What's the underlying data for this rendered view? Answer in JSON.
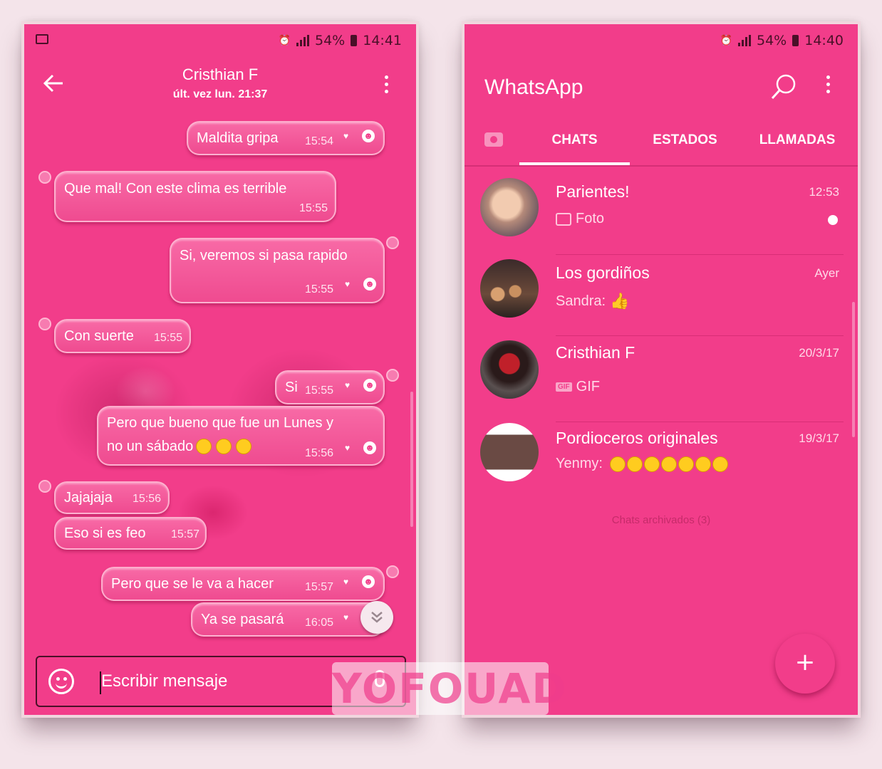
{
  "left_phone": {
    "status": {
      "battery": "54%",
      "time": "14:41"
    },
    "header": {
      "title": "Cristhian F",
      "subtitle": "últ. vez lun. 21:37"
    },
    "messages": [
      {
        "text": "Maldita gripa",
        "time": "15:54",
        "dir": "out"
      },
      {
        "text": "Que mal!  Con este clima es terrible",
        "time": "15:55",
        "dir": "in"
      },
      {
        "text": "Si, veremos si pasa rapido",
        "time": "15:55",
        "dir": "out"
      },
      {
        "text": "Con suerte",
        "time": "15:55",
        "dir": "in"
      },
      {
        "text": "Si",
        "time": "15:55",
        "dir": "out"
      },
      {
        "text": "Pero que bueno que fue un Lunes y",
        "text2": "no un sábado",
        "time": "15:56",
        "dir": "out"
      },
      {
        "text": "Jajajaja",
        "time": "15:56",
        "dir": "in"
      },
      {
        "text": "Eso si es feo",
        "time": "15:57",
        "dir": "in"
      },
      {
        "text": "Pero que se le va a hacer",
        "time": "15:57",
        "dir": "out"
      },
      {
        "text": "Ya se pasará",
        "time": "16:05",
        "dir": "out"
      }
    ],
    "composer": {
      "placeholder": "Escribir mensaje"
    }
  },
  "right_phone": {
    "status": {
      "battery": "54%",
      "time": "14:40"
    },
    "app_title": "WhatsApp",
    "tabs": [
      "CHATS",
      "ESTADOS",
      "LLAMADAS"
    ],
    "active_tab": "CHATS",
    "chats": [
      {
        "name": "Parientes!",
        "time": "12:53",
        "preview": "Foto",
        "preview_type": "photo"
      },
      {
        "name": "Los gordiños",
        "time": "Ayer",
        "preview": "Sandra:",
        "preview_type": "thumb"
      },
      {
        "name": "Cristhian F",
        "time": "20/3/17",
        "preview": "GIF",
        "preview_type": "gif"
      },
      {
        "name": "Pordioceros originales",
        "time": "19/3/17",
        "preview": "Yenmy:",
        "preview_type": "emojis"
      }
    ],
    "archived": "Chats archivados (3)",
    "fab_label": "+"
  },
  "watermark": "YOFOUAD",
  "colors": {
    "accent": "#f23d8a",
    "bubble": "#f45d9d",
    "dark": "#4a1028"
  }
}
